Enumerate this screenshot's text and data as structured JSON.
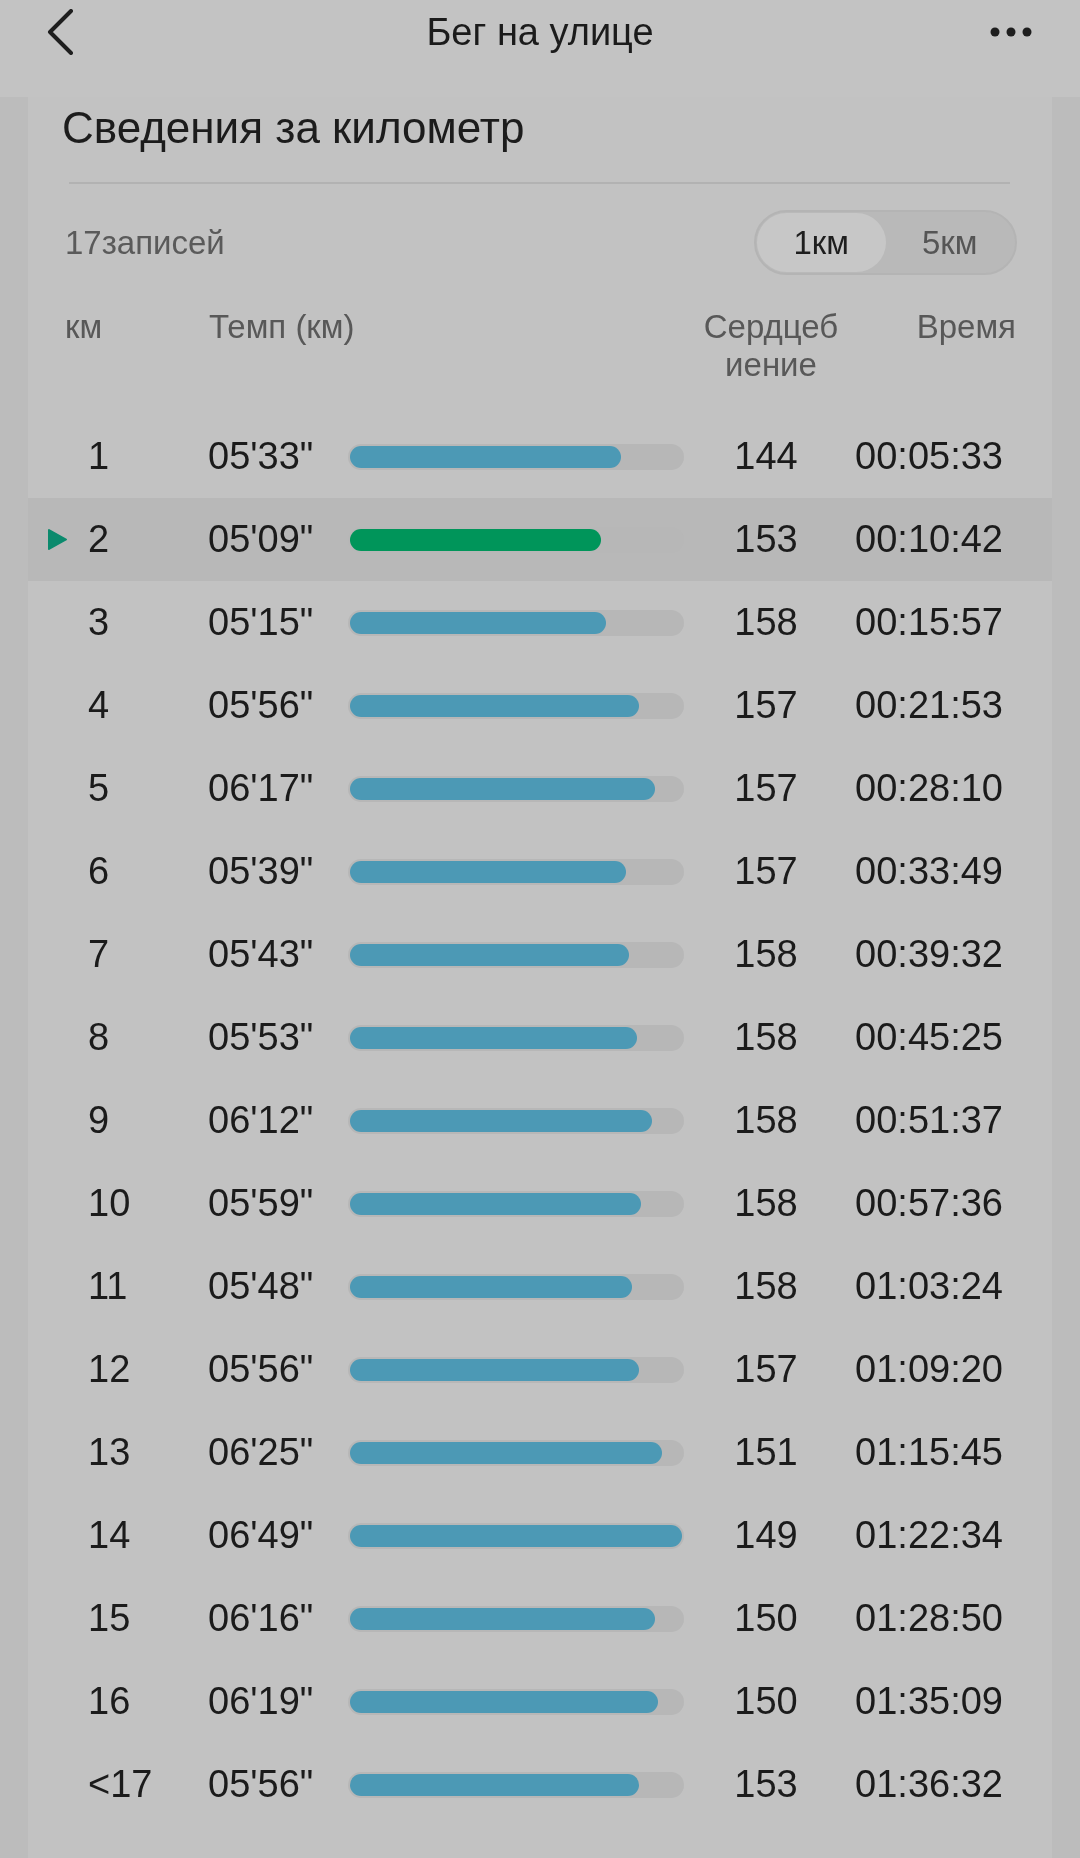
{
  "header": {
    "title": "Бег на улице"
  },
  "section": {
    "title": "Сведения за километр",
    "record_count": "17записей",
    "segments": [
      {
        "label": "1км",
        "selected": true
      },
      {
        "label": "5км",
        "selected": false
      }
    ]
  },
  "columns": [
    "км",
    "Темп (км)",
    "Сердцебиение",
    "Время"
  ],
  "rows": [
    {
      "km": "1",
      "pace": "05'33\"",
      "level": 0.815,
      "heart_rate": "144",
      "time": "00:05:33",
      "selected": false
    },
    {
      "km": "2",
      "pace": "05'09\"",
      "level": 0.755,
      "heart_rate": "153",
      "time": "00:10:42",
      "selected": true
    },
    {
      "km": "3",
      "pace": "05'15\"",
      "level": 0.77,
      "heart_rate": "158",
      "time": "00:15:57",
      "selected": false
    },
    {
      "km": "4",
      "pace": "05'56\"",
      "level": 0.87,
      "heart_rate": "157",
      "time": "00:21:53",
      "selected": false
    },
    {
      "km": "5",
      "pace": "06'17\"",
      "level": 0.92,
      "heart_rate": "157",
      "time": "00:28:10",
      "selected": false
    },
    {
      "km": "6",
      "pace": "05'39\"",
      "level": 0.83,
      "heart_rate": "157",
      "time": "00:33:49",
      "selected": false
    },
    {
      "km": "7",
      "pace": "05'43\"",
      "level": 0.84,
      "heart_rate": "158",
      "time": "00:39:32",
      "selected": false
    },
    {
      "km": "8",
      "pace": "05'53\"",
      "level": 0.865,
      "heart_rate": "158",
      "time": "00:45:25",
      "selected": false
    },
    {
      "km": "9",
      "pace": "06'12\"",
      "level": 0.91,
      "heart_rate": "158",
      "time": "00:51:37",
      "selected": false
    },
    {
      "km": "10",
      "pace": "05'59\"",
      "level": 0.875,
      "heart_rate": "158",
      "time": "00:57:36",
      "selected": false
    },
    {
      "km": "11",
      "pace": "05'48\"",
      "level": 0.85,
      "heart_rate": "158",
      "time": "01:03:24",
      "selected": false
    },
    {
      "km": "12",
      "pace": "05'56\"",
      "level": 0.87,
      "heart_rate": "157",
      "time": "01:09:20",
      "selected": false
    },
    {
      "km": "13",
      "pace": "06'25\"",
      "level": 0.94,
      "heart_rate": "151",
      "time": "01:15:45",
      "selected": false
    },
    {
      "km": "14",
      "pace": "06'49\"",
      "level": 1.0,
      "heart_rate": "149",
      "time": "01:22:34",
      "selected": false
    },
    {
      "km": "15",
      "pace": "06'16\"",
      "level": 0.92,
      "heart_rate": "150",
      "time": "01:28:50",
      "selected": false
    },
    {
      "km": "16",
      "pace": "06'19\"",
      "level": 0.927,
      "heart_rate": "150",
      "time": "01:35:09",
      "selected": false
    },
    {
      "km": "<17",
      "pace": "05'56\"",
      "level": 0.87,
      "heart_rate": "153",
      "time": "01:36:32",
      "selected": false
    }
  ]
}
